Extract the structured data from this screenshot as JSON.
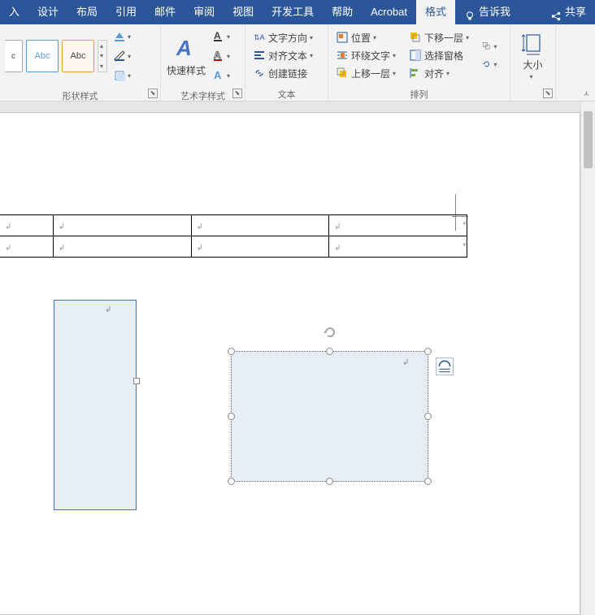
{
  "tabs": {
    "insert": "入",
    "design": "设计",
    "layout": "布局",
    "references": "引用",
    "mail": "邮件",
    "review": "审阅",
    "view": "视图",
    "devtools": "开发工具",
    "help": "帮助",
    "acrobat": "Acrobat",
    "format": "格式",
    "tellme": "告诉我",
    "share": "共享"
  },
  "ribbon": {
    "shape_styles_label": "形状样式",
    "swatch_text": "Abc",
    "wordart_label": "艺术字样式",
    "wordart_btn": "快速样式",
    "text_group_label": "文本",
    "text_direction": "文字方向",
    "align_text": "对齐文本",
    "create_link": "创建链接",
    "arrange_label": "排列",
    "position": "位置",
    "wrap_text": "环绕文字",
    "bring_forward": "上移一层",
    "send_backward": "下移一层",
    "selection_pane": "选择窗格",
    "align": "对齐",
    "size_label": "大小"
  },
  "shapes": {
    "layout_options_tooltip": "布局选项"
  }
}
